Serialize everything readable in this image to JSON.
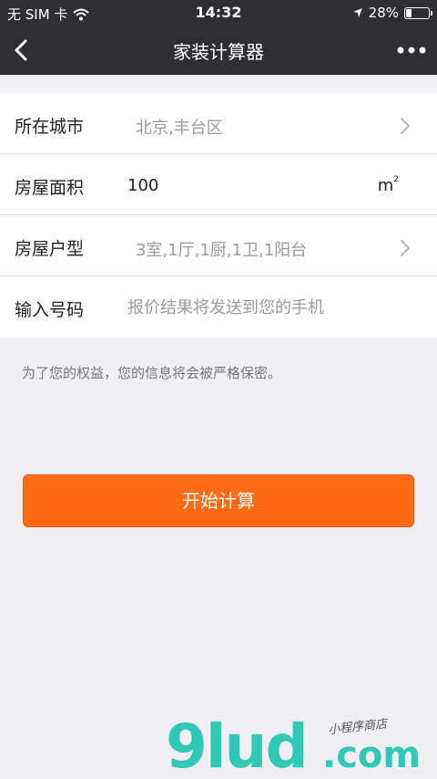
{
  "status_bar": {
    "carrier": "无 SIM 卡",
    "time": "14:32",
    "battery_percent": "28%",
    "battery_level": 0.28,
    "icons": [
      "wifi-icon",
      "location-arrow-icon",
      "battery-icon"
    ]
  },
  "nav": {
    "title": "家装计算器",
    "back_icon": "chevron-left-icon",
    "more_icon": "more-dots-icon"
  },
  "form": {
    "city": {
      "label": "所在城市",
      "value": "北京,丰台区"
    },
    "area": {
      "label": "房屋面积",
      "value": "100",
      "unit": "m",
      "unit_sup": "2"
    },
    "layout": {
      "label": "房屋户型",
      "value": "3室,1厅,1厨,1卫,1阳台"
    },
    "phone": {
      "label": "输入号码",
      "placeholder": "报价结果将发送到您的手机"
    }
  },
  "notice": "为了您的权益，您的信息将会被严格保密。",
  "cta": {
    "label": "开始计算",
    "color": "#ff6a14"
  },
  "watermark": {
    "brand": "9lud",
    "domain": ".com",
    "tagline": "小程序商店",
    "color": "#31c8b6"
  },
  "colors": {
    "header_bg": "#2e2e33",
    "page_bg": "#efeff4"
  }
}
